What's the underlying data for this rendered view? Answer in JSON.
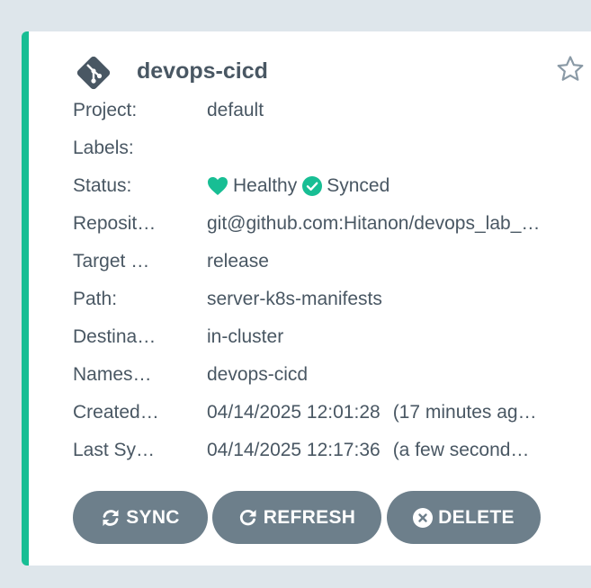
{
  "app": {
    "name": "devops-cicd",
    "icon": "git-diamond-icon"
  },
  "details": [
    {
      "key": "project",
      "label": "Project:",
      "value": "default"
    },
    {
      "key": "labels",
      "label": "Labels:",
      "value": ""
    },
    {
      "key": "status",
      "label": "Status:",
      "health": "Healthy",
      "sync": "Synced"
    },
    {
      "key": "repository",
      "label": "Reposit…",
      "value": "git@github.com:Hitanon/devops_lab_…"
    },
    {
      "key": "target",
      "label": "Target …",
      "value": "release"
    },
    {
      "key": "path",
      "label": "Path:",
      "value": "server-k8s-manifests"
    },
    {
      "key": "destination",
      "label": "Destina…",
      "value": "in-cluster"
    },
    {
      "key": "namespace",
      "label": "Names…",
      "value": "devops-cicd"
    },
    {
      "key": "created",
      "label": "Created…",
      "time": "04/14/2025 12:01:28",
      "relative": "(17 minutes ag…"
    },
    {
      "key": "last_sync",
      "label": "Last Sy…",
      "time": "04/14/2025 12:17:36",
      "relative": "(a few second…"
    }
  ],
  "buttons": {
    "sync": "SYNC",
    "refresh": "REFRESH",
    "delete": "DELETE"
  },
  "colors": {
    "accent": "#18be94",
    "healthy": "#18be94",
    "synced": "#18be94",
    "button_bg": "#6d7f8b",
    "text": "#495763",
    "background": "#dee6eb"
  },
  "icons": {
    "favorite": "star-outline-icon",
    "health": "heart-icon",
    "sync_status": "check-circle-icon",
    "sync_button": "sync-arrows-icon",
    "refresh_button": "refresh-icon",
    "delete_button": "x-circle-icon"
  }
}
